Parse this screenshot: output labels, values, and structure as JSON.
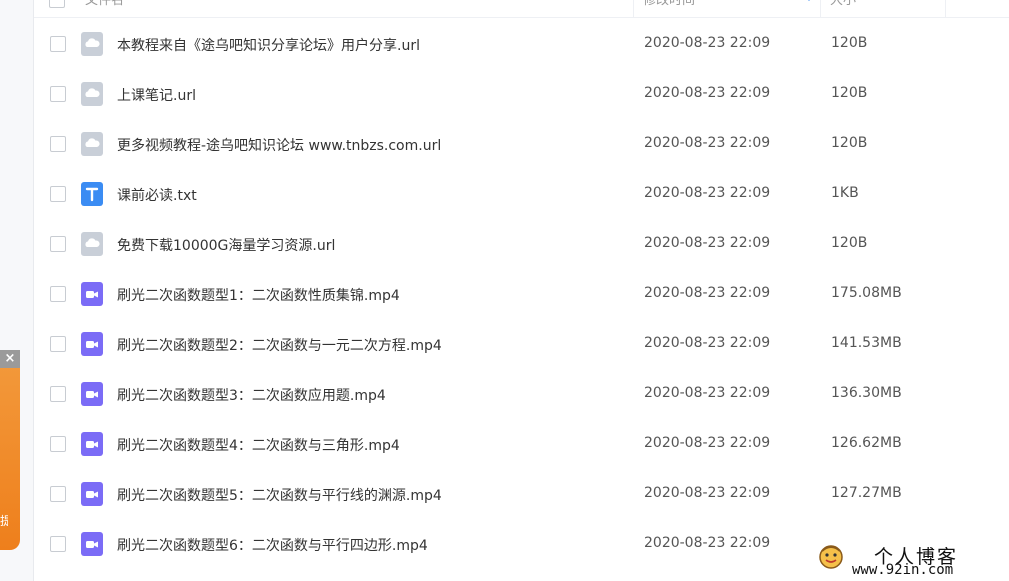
{
  "header": {
    "name_label": "文件名",
    "modified_label": "修改时间",
    "size_label": "大小"
  },
  "colors": {
    "link_icon": "#c9cfd8",
    "txt_icon": "#3b8cf3",
    "video_icon": "#7b6cf6",
    "promo": "#f08a2a"
  },
  "files": [
    {
      "icon": "link-file-icon",
      "name": "本教程来自《途乌吧知识分享论坛》用户分享.url",
      "modified": "2020-08-23 22:09",
      "size": "120B"
    },
    {
      "icon": "link-file-icon",
      "name": "上课笔记.url",
      "modified": "2020-08-23 22:09",
      "size": "120B"
    },
    {
      "icon": "link-file-icon",
      "name": "更多视频教程-途乌吧知识论坛 www.tnbzs.com.url",
      "modified": "2020-08-23 22:09",
      "size": "120B"
    },
    {
      "icon": "text-file-icon",
      "name": "课前必读.txt",
      "modified": "2020-08-23 22:09",
      "size": "1KB"
    },
    {
      "icon": "link-file-icon",
      "name": "免费下载10000G海量学习资源.url",
      "modified": "2020-08-23 22:09",
      "size": "120B"
    },
    {
      "icon": "video-file-icon",
      "name": "刷光二次函数题型1：二次函数性质集锦.mp4",
      "modified": "2020-08-23 22:09",
      "size": "175.08MB"
    },
    {
      "icon": "video-file-icon",
      "name": "刷光二次函数题型2：二次函数与一元二次方程.mp4",
      "modified": "2020-08-23 22:09",
      "size": "141.53MB"
    },
    {
      "icon": "video-file-icon",
      "name": "刷光二次函数题型3：二次函数应用题.mp4",
      "modified": "2020-08-23 22:09",
      "size": "136.30MB"
    },
    {
      "icon": "video-file-icon",
      "name": "刷光二次函数题型4：二次函数与三角形.mp4",
      "modified": "2020-08-23 22:09",
      "size": "126.62MB"
    },
    {
      "icon": "video-file-icon",
      "name": "刷光二次函数题型5：二次函数与平行线的渊源.mp4",
      "modified": "2020-08-23 22:09",
      "size": "127.27MB"
    },
    {
      "icon": "video-file-icon",
      "name": "刷光二次函数题型6：二次函数与平行四边形.mp4",
      "modified": "2020-08-23 22:09",
      "size": ""
    }
  ],
  "promo": {
    "close": "×"
  },
  "watermark": {
    "title": "个人博客",
    "url": "www.92in.com"
  }
}
